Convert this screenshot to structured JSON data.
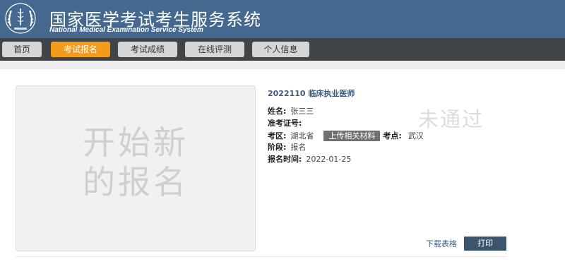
{
  "header": {
    "title_cn": "国家医学考试考生服务系统",
    "title_en": "National Medical Examination Service System",
    "logo_icon": "laurel-emblem-icon",
    "bg_color": "#45688f"
  },
  "nav": {
    "items": [
      {
        "label": "首页"
      },
      {
        "label": "考试报名",
        "active": true
      },
      {
        "label": "考试成绩"
      },
      {
        "label": "在线评测"
      },
      {
        "label": "个人信息"
      }
    ],
    "active_color": "#f39c1b"
  },
  "new_registration": {
    "line1": "开始新",
    "line2": "的报名"
  },
  "exam": {
    "title": "2022110 临床执业医师",
    "name_label": "姓名:",
    "name_value": "张三三",
    "ticket_label": "准考证号:",
    "ticket_value": "",
    "area_label": "考区:",
    "area_value": "湖北省",
    "upload_label": "上传相关材料",
    "site_label": "考点:",
    "site_value": "武汉",
    "stage_label": "阶段:",
    "stage_value": "报名",
    "time_label": "报名时间:",
    "time_value": "2022-01-25",
    "status": "未通过"
  },
  "actions": {
    "download_label": "下载表格",
    "print_label": "打印"
  }
}
